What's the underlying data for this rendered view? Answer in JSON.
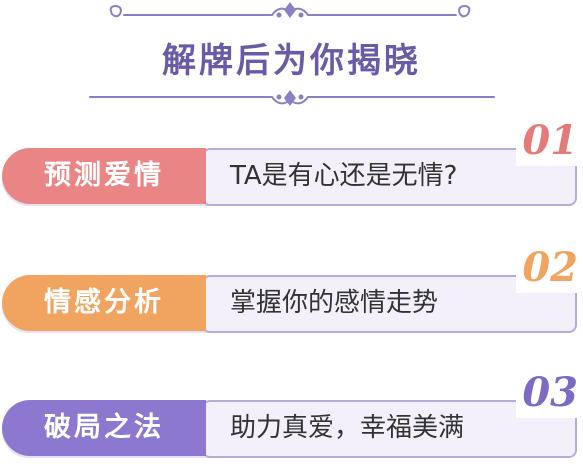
{
  "header": {
    "title": "解牌后为你揭晓"
  },
  "colors": {
    "title": "#6b5aa7",
    "ornament": "#8d7fc4",
    "card_box_bg": "#f3f0fb",
    "card_box_border": "#b7acd8",
    "card_1_accent": "#e98585",
    "card_2_accent": "#f0a45f",
    "card_3_accent": "#8c79cf"
  },
  "cards": [
    {
      "number": "01",
      "label": "预测爱情",
      "text": "TA是有心还是无情?"
    },
    {
      "number": "02",
      "label": "情感分析",
      "text": "掌握你的感情走势"
    },
    {
      "number": "03",
      "label": "破局之法",
      "text": "助力真爱，幸福美满"
    }
  ]
}
